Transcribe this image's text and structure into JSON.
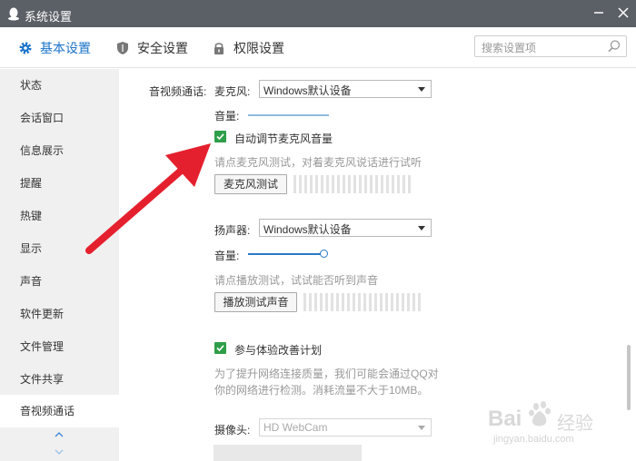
{
  "window": {
    "title": "系统设置",
    "icons": {
      "app": "qq-penguin-icon",
      "minimize": "minimize-icon",
      "close": "close-icon"
    }
  },
  "tabs": [
    {
      "label": "基本设置",
      "icon": "gear-icon",
      "active": true
    },
    {
      "label": "安全设置",
      "icon": "shield-icon",
      "active": false
    },
    {
      "label": "权限设置",
      "icon": "lock-icon",
      "active": false
    }
  ],
  "search": {
    "placeholder": "搜索设置项",
    "icon": "search-icon"
  },
  "sidebar": {
    "items": [
      {
        "label": "状态"
      },
      {
        "label": "会话窗口"
      },
      {
        "label": "信息展示"
      },
      {
        "label": "提醒"
      },
      {
        "label": "热键"
      },
      {
        "label": "显示"
      },
      {
        "label": "声音"
      },
      {
        "label": "软件更新"
      },
      {
        "label": "文件管理"
      },
      {
        "label": "文件共享"
      },
      {
        "label": "音视频通话",
        "active": true
      }
    ],
    "scroll_icons": [
      "chevron-up-icon",
      "chevron-down-icon"
    ]
  },
  "section": {
    "title": "音视频通话:",
    "microphone": {
      "label": "麦克风:",
      "device": "Windows默认设备",
      "volume_label": "音量:",
      "volume_level": 1.0,
      "auto_adjust": {
        "label": "自动调节麦克风音量",
        "checked": true
      },
      "hint": "请点麦克风测试，对着麦克风说话进行试听",
      "test_button": "麦克风测试"
    },
    "speaker": {
      "label": "扬声器:",
      "device": "Windows默认设备",
      "volume_label": "音量:",
      "volume_level": 0.95,
      "hint": "请点播放测试，试试能否听到声音",
      "test_button": "播放测试声音"
    },
    "experience": {
      "checkbox_label": "参与体验改善计划",
      "checked": true,
      "description_line1": "为了提升网络连接质量，我们可能会通过QQ对",
      "description_line2": "你的网络进行检测。消耗流量不大于10MB。"
    },
    "camera": {
      "label": "摄像头:",
      "device": "HD WebCam"
    }
  },
  "watermark": {
    "brand": "Bai",
    "brand_tail": "经验",
    "url": "jingyan.baidu.com"
  },
  "colors": {
    "titlebar": "#5b5f66",
    "accent": "#1a73c9",
    "checkbox": "#2f9e49",
    "arrow": "#e5202e",
    "sidebar_bg": "#f0f0f0"
  }
}
